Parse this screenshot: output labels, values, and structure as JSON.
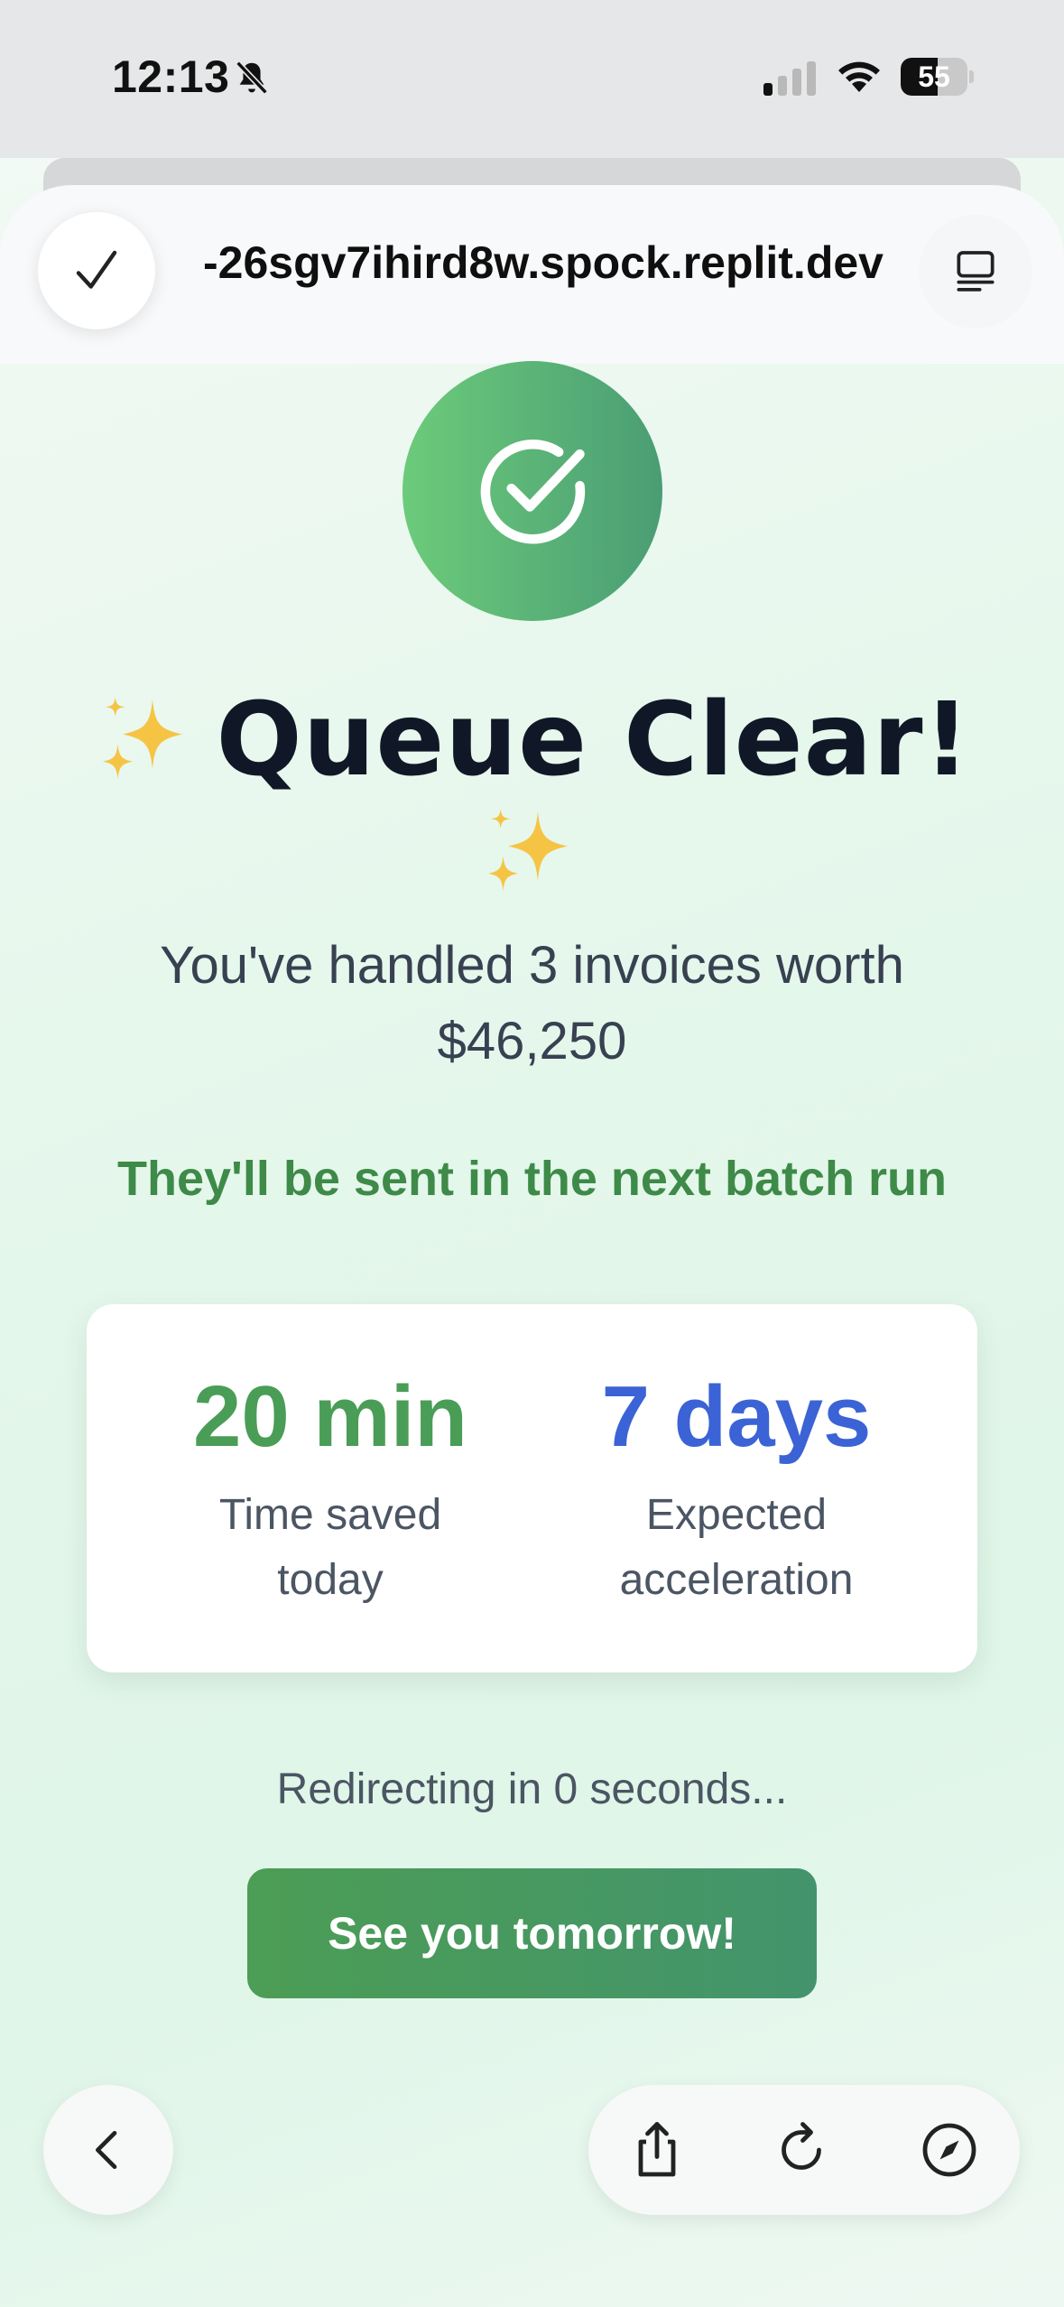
{
  "status_bar": {
    "time": "12:13",
    "battery_level": "55",
    "silent_mode": true
  },
  "browser": {
    "url": "-26sgv7ihird8w.spock.replit.dev"
  },
  "success": {
    "title": "Queue Clear!",
    "summary": "You've handled 3 invoices worth $46,250",
    "batch_note": "They'll be sent in the next batch run"
  },
  "stats": [
    {
      "value": "20 min",
      "label_line1": "Time saved",
      "label_line2": "today",
      "color": "#4a9d56"
    },
    {
      "value": "7 days",
      "label_line1": "Expected",
      "label_line2": "acceleration",
      "color": "#3b63d6"
    }
  ],
  "redirect_text": "Redirecting in 0 seconds...",
  "cta_label": "See you tomorrow!",
  "colors": {
    "accent_green": "#4a9d56",
    "accent_blue": "#3b63d6",
    "badge_gradient_start": "#6ccb7a",
    "badge_gradient_end": "#4a9d74"
  },
  "icons": {
    "check": "check-icon",
    "reader": "reader-icon",
    "back": "chevron-left-icon",
    "share": "share-icon",
    "reload": "reload-icon",
    "compass": "compass-icon"
  }
}
